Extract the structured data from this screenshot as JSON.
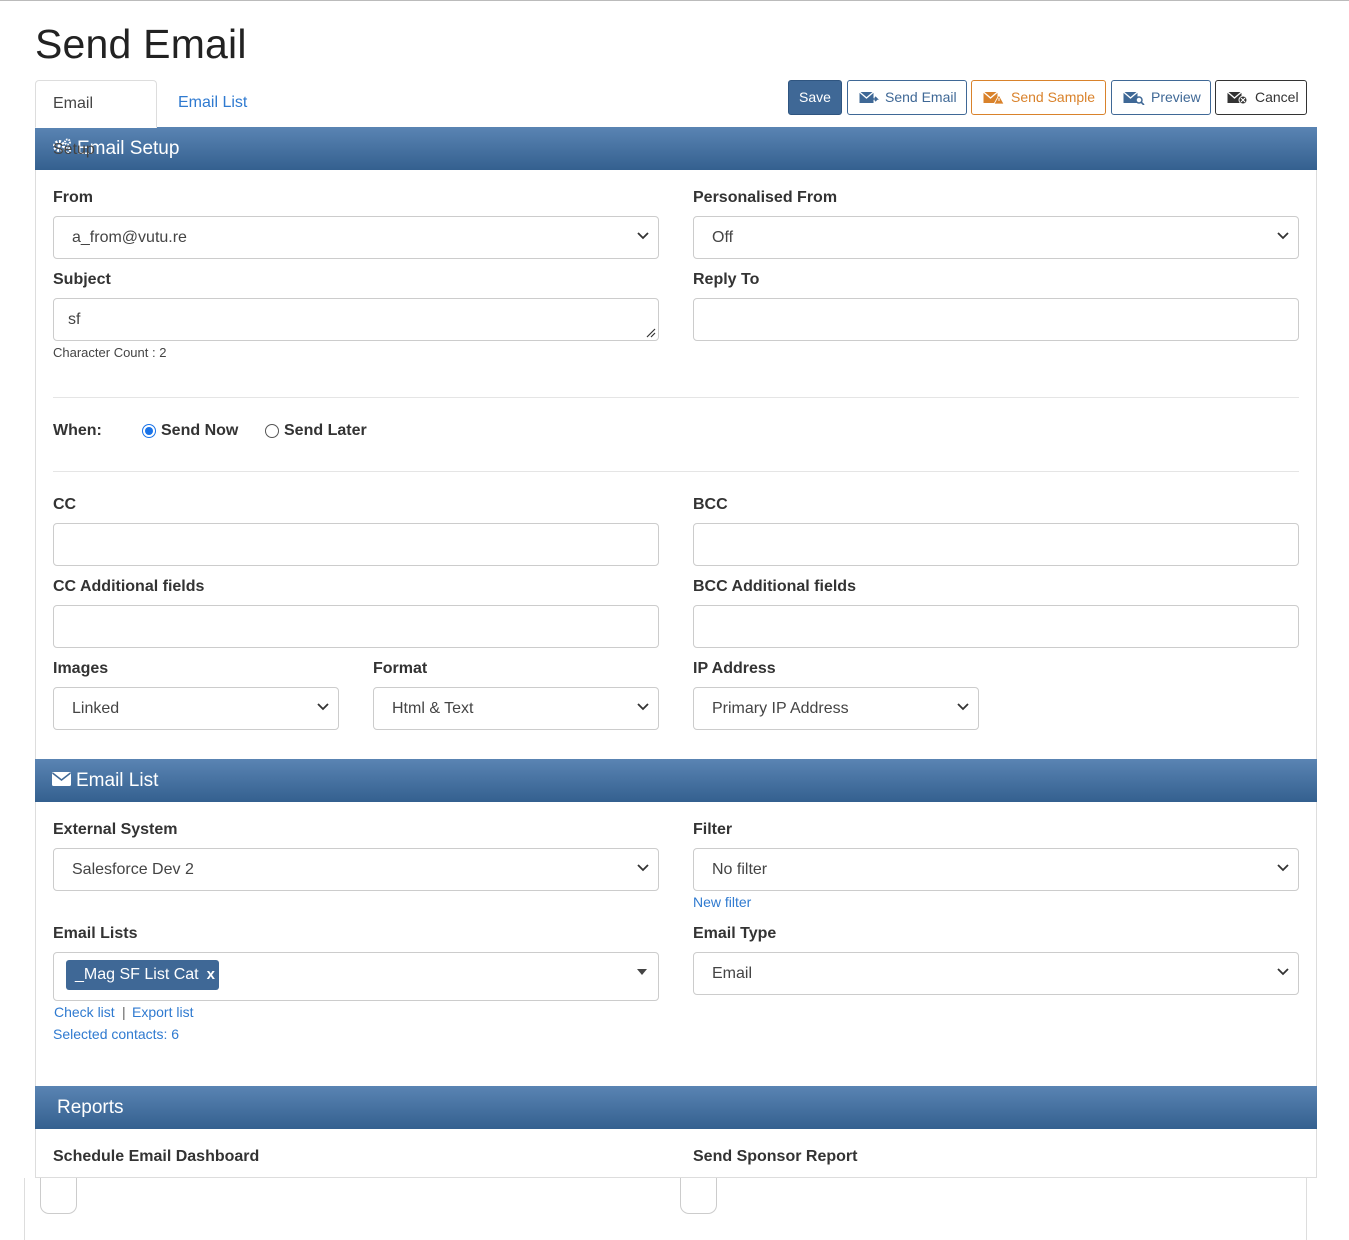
{
  "page": {
    "title": "Send Email"
  },
  "tabs": [
    {
      "label": "Email Setup",
      "active": true
    },
    {
      "label": "Email List",
      "active": false
    }
  ],
  "toolbar": {
    "save": "Save",
    "send_email": "Send Email",
    "send_sample": "Send Sample",
    "preview": "Preview",
    "cancel": "Cancel"
  },
  "colors": {
    "header": "#3f6896",
    "link": "#2f7ad0",
    "sample": "#d9822b"
  },
  "email_setup": {
    "header": "Email Setup",
    "from": {
      "label": "From",
      "value": "a_from@vutu.re"
    },
    "personalised_from": {
      "label": "Personalised From",
      "value": "Off"
    },
    "subject": {
      "label": "Subject",
      "value": "sf",
      "char_count": "Character Count : 2"
    },
    "reply_to": {
      "label": "Reply To",
      "value": ""
    },
    "when": {
      "label": "When:",
      "options": [
        "Send Now",
        "Send Later"
      ],
      "selected": "Send Now"
    },
    "cc": {
      "label": "CC",
      "value": ""
    },
    "bcc": {
      "label": "BCC",
      "value": ""
    },
    "cc_additional": {
      "label": "CC Additional fields",
      "value": ""
    },
    "bcc_additional": {
      "label": "BCC Additional fields",
      "value": ""
    },
    "images": {
      "label": "Images",
      "value": "Linked"
    },
    "format": {
      "label": "Format",
      "value": "Html & Text"
    },
    "ip_address": {
      "label": "IP Address",
      "value": "Primary IP Address"
    }
  },
  "email_list": {
    "header": "Email List",
    "external_system": {
      "label": "External System",
      "value": "Salesforce Dev 2"
    },
    "filter": {
      "label": "Filter",
      "value": "No filter",
      "new_filter": "New filter"
    },
    "email_lists": {
      "label": "Email Lists",
      "tags": [
        "_Mag SF List Cat"
      ],
      "remove": "x"
    },
    "email_type": {
      "label": "Email Type",
      "value": "Email"
    },
    "check_list": "Check list",
    "separator": "|",
    "export_list": "Export list",
    "selected_contacts": "Selected contacts: 6"
  },
  "reports": {
    "header": "Reports",
    "schedule_dashboard": {
      "label": "Schedule Email Dashboard"
    },
    "sponsor_report": {
      "label": "Send Sponsor Report"
    }
  }
}
